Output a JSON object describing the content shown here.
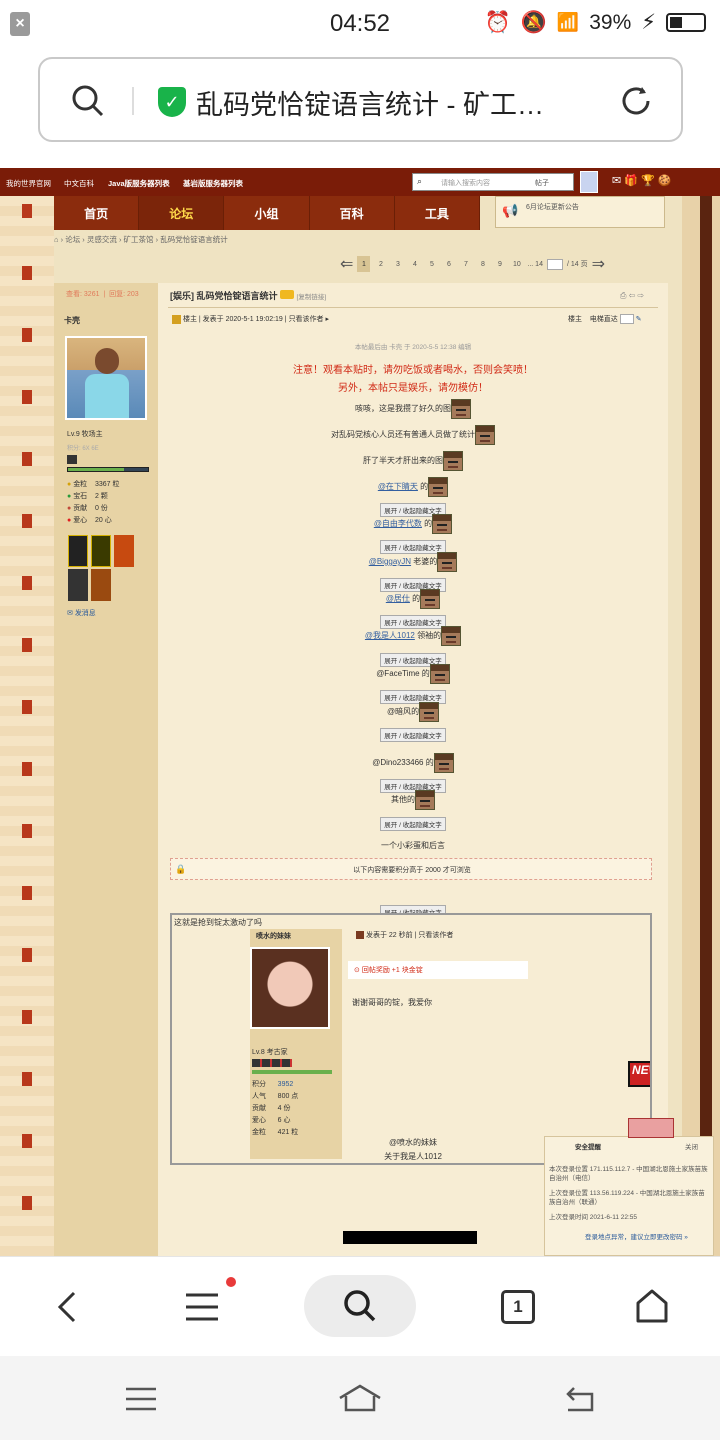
{
  "status_bar": {
    "time": "04:52",
    "battery": "39%"
  },
  "address_bar": {
    "title": "乱码党恰锭语言统计 - 矿工…"
  },
  "site_nav": {
    "links": [
      "我的世界官网",
      "中文百科",
      "Java版服务器列表",
      "基岩版服务器列表"
    ],
    "search_placeholder": "请输入搜索内容",
    "search_scope": "帖子"
  },
  "main_nav": {
    "tabs": [
      "首页",
      "论坛",
      "小组",
      "百科",
      "工具"
    ],
    "active": "论坛"
  },
  "notice": "6月论坛更新公告",
  "breadcrumb": [
    "论坛",
    "灵感交流",
    "矿工茶馆",
    "乱码党恰锭语言统计"
  ],
  "pager": {
    "pages": [
      "1",
      "2",
      "3",
      "4",
      "5",
      "6",
      "7",
      "8",
      "9",
      "10",
      "... 14"
    ],
    "current": "1",
    "total": "/ 14 页"
  },
  "author": {
    "views_label": "查看:",
    "views": "3261",
    "replies_label": "回复:",
    "replies": "203",
    "name": "卡壳",
    "level": "Lv.9 牧场主",
    "sub_line": "积分: 6X 6E",
    "stats": [
      {
        "label": "金粒",
        "value": "3367 粒"
      },
      {
        "label": "宝石",
        "value": "2 颗"
      },
      {
        "label": "贡献",
        "value": "0 份"
      },
      {
        "label": "爱心",
        "value": "20 心"
      }
    ],
    "send_message": "发消息"
  },
  "post": {
    "title": "[娱乐] 乱码党恰锭语言统计",
    "copy_link": "[复制链接]",
    "meta_author": "楼主",
    "posted_at": "发表于 2020-5-1 19:02:19",
    "only_author": "只看该作者",
    "floor": "楼主",
    "jump": "电梯直达",
    "edited": "本帖最后由 卡壳 于 2020-5-5 12:38 编辑",
    "warning_line1": "注意！观看本贴时，请勿吃饭或者喝水，否则会笑喷！",
    "warning_line2": "另外，本帖只是娱乐，请勿模仿！",
    "intro": [
      "咳咳，这是我攒了好久的图",
      "对乱码党核心人员还有普通人员做了统计",
      "肝了半天才肝出来的图"
    ],
    "entries": [
      {
        "name": "@在下睛天",
        "suffix": " 的",
        "linked": true
      },
      {
        "name": "@自由李代数",
        "suffix": " 的",
        "linked": true
      },
      {
        "name": "@BiggayJN",
        "suffix": " 老婆的",
        "linked": true
      },
      {
        "name": "@居仕",
        "suffix": " 的",
        "linked": true
      },
      {
        "name": "@我是人1012",
        "suffix": " 领袖的",
        "linked": true
      },
      {
        "name": "@FaceTime",
        "suffix": " 的",
        "linked": false
      },
      {
        "name": "@暗风",
        "suffix": "的",
        "linked": false
      },
      {
        "name": "@Dino233466",
        "suffix": " 的",
        "linked": false
      },
      {
        "name": "其他",
        "suffix": "的",
        "linked": false
      }
    ],
    "toggle_label": "展开 / 收起隐藏文字",
    "easter_egg": "一个小彩蛋和后言",
    "locked_text": "以下内容需要积分高于 2000 才可浏览"
  },
  "quote": {
    "caption": "这就是抢到锭太激动了吗",
    "poster_name": "喷水的妹妹",
    "posted_at": "发表于 22 秒前",
    "only_author": "只看该作者",
    "reward": "回帖奖励 +1 块金锭",
    "body": "谢谢哥哥的锭，我爱你",
    "level": "Lv.8 考古家",
    "stats": [
      {
        "label": "积分",
        "value": "3952"
      },
      {
        "label": "人气",
        "value": "800 点"
      },
      {
        "label": "贡献",
        "value": "4 份"
      },
      {
        "label": "爱心",
        "value": "6 心"
      },
      {
        "label": "金粒",
        "value": "421 粒"
      }
    ],
    "mention": "@喷水的妹妹",
    "about": "关于我是人1012",
    "new_badge": "NEW"
  },
  "security_popup": {
    "title": "安全提醒",
    "close": "关闭",
    "line1": "本次登录位置 171.115.112.7 - 中国湖北恩施土家族苗族自治州（电信）",
    "line2": "上次登录位置 113.56.119.224 - 中国湖北恩施土家族苗族自治州（联通）",
    "line3": "上次登录时间 2021-6-11 22:55",
    "link": "登录地点异常，建议立即更改密码 »"
  },
  "browser_nav": {
    "tab_count": "1"
  }
}
